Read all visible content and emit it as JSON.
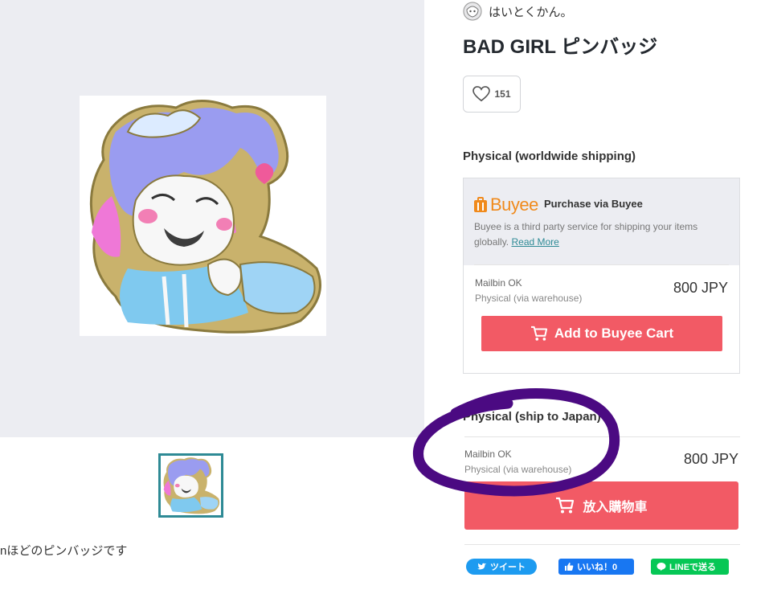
{
  "shop": {
    "name": "はいとくかん。"
  },
  "product": {
    "title": "BAD GIRL ピンバッジ",
    "description": "nほどのピンバッジです"
  },
  "like": {
    "count": "151"
  },
  "worldwide": {
    "section_title": "Physical (worldwide shipping)",
    "buyee": {
      "logo_text": "Buyee",
      "purchase_label": "Purchase via Buyee",
      "description": "Buyee is a third party service for shipping your items globally.",
      "read_more": "Read More"
    },
    "variant": {
      "name": "Mailbin OK",
      "type": "Physical (via warehouse)",
      "price": "800 JPY"
    },
    "add_button": "Add to Buyee Cart"
  },
  "japan": {
    "section_title": "Physical (ship to Japan)",
    "variant": {
      "name": "Mailbin OK",
      "type": "Physical (via warehouse)",
      "price": "800 JPY"
    },
    "cart_button": "放入購物車"
  },
  "share": {
    "tweet": "ツイート",
    "fb_like": "いいね！0",
    "line": "LINEで送る"
  },
  "colors": {
    "accent_red": "#f25a65",
    "teal": "#2e8a95",
    "annotation_purple": "#4b0a82",
    "buyee_orange": "#f08a1c"
  },
  "icons": [
    "heart-icon",
    "cart-icon",
    "twitter-bird-icon",
    "thumbs-up-icon",
    "line-icon",
    "buyee-bag-icon"
  ]
}
